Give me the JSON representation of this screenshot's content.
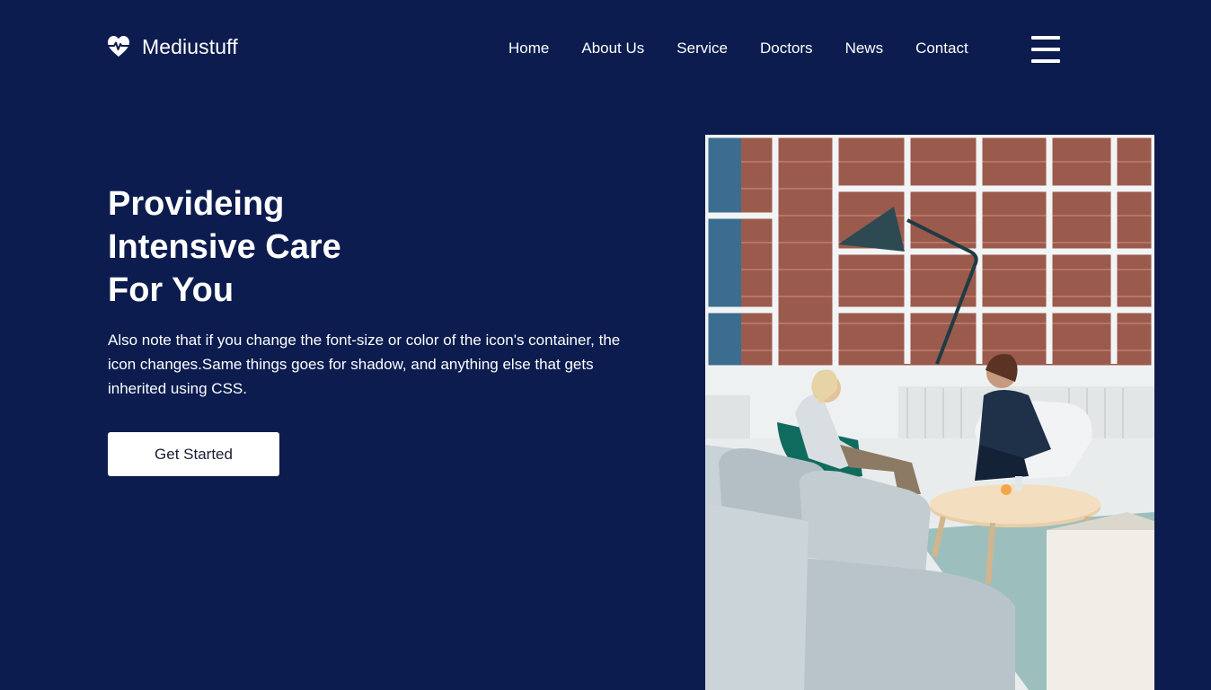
{
  "brand": {
    "name": "Mediustuff",
    "icon": "heartbeat-icon"
  },
  "nav": {
    "items": [
      {
        "label": "Home"
      },
      {
        "label": "About Us"
      },
      {
        "label": "Service"
      },
      {
        "label": "Doctors"
      },
      {
        "label": "News"
      },
      {
        "label": "Contact"
      }
    ],
    "menu_icon": "hamburger-menu-icon"
  },
  "hero": {
    "title_lines": [
      "Provideing",
      "Intensive Care",
      "For You"
    ],
    "text": "Also note that if you change the font-size or color of the icon's container, the icon changes.Same things goes for shadow, and anything else that gets inherited using CSS.",
    "cta_label": "Get Started"
  },
  "colors": {
    "background": "#0c1c4f",
    "text": "#ffffff",
    "button_bg": "#ffffff",
    "button_text": "#1a1f33"
  }
}
